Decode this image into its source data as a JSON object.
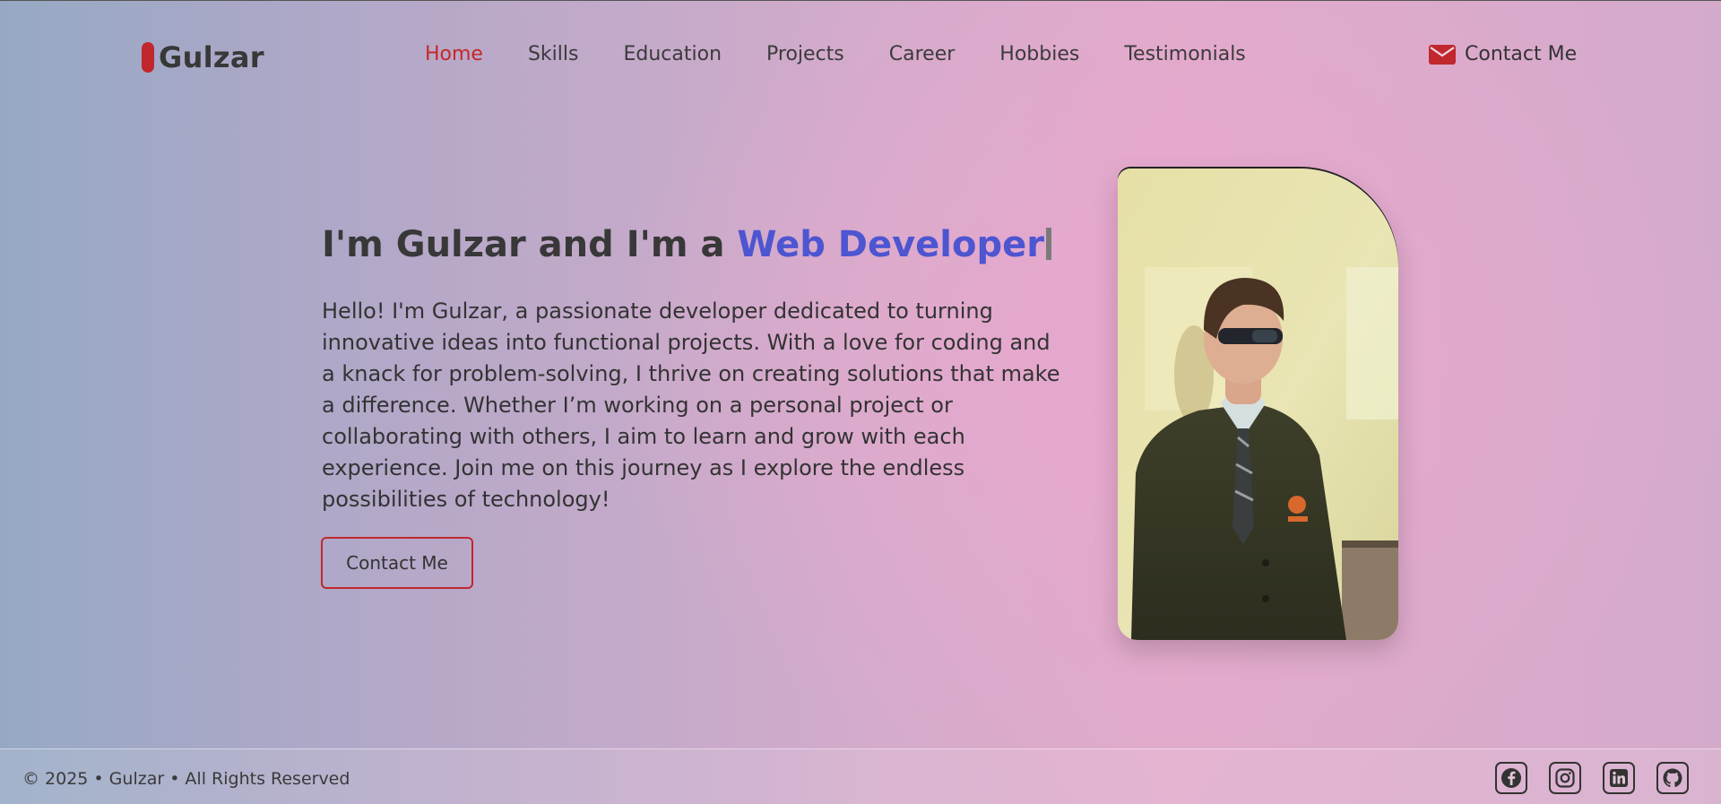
{
  "brand": {
    "name": "Gulzar",
    "accent_color": "#c0282d"
  },
  "nav": {
    "items": [
      {
        "label": "Home",
        "active": true
      },
      {
        "label": "Skills",
        "active": false
      },
      {
        "label": "Education",
        "active": false
      },
      {
        "label": "Projects",
        "active": false
      },
      {
        "label": "Career",
        "active": false
      },
      {
        "label": "Hobbies",
        "active": false
      },
      {
        "label": "Testimonials",
        "active": false
      }
    ],
    "active_color": "#c62828",
    "contact_label": "Contact Me",
    "contact_icon": "envelope-icon"
  },
  "hero": {
    "title_prefix": "I'm Gulzar and I'm a",
    "title_highlight": "Web Developer",
    "highlight_color": "#4d55d1",
    "description": "Hello! I'm Gulzar, a passionate developer dedicated to turning innovative ideas into functional projects. With a love for coding and a knack for problem-solving, I thrive on creating solutions that make a difference. Whether I’m working on a personal project or collaborating with others, I aim to learn and grow with each experience. Join me on this journey as I explore the endless possibilities of technology!",
    "button_label": "Contact Me"
  },
  "footer": {
    "copyright": "© 2025 • Gulzar • All Rights Reserved",
    "socials": [
      "facebook-icon",
      "instagram-icon",
      "linkedin-icon",
      "github-icon"
    ]
  }
}
